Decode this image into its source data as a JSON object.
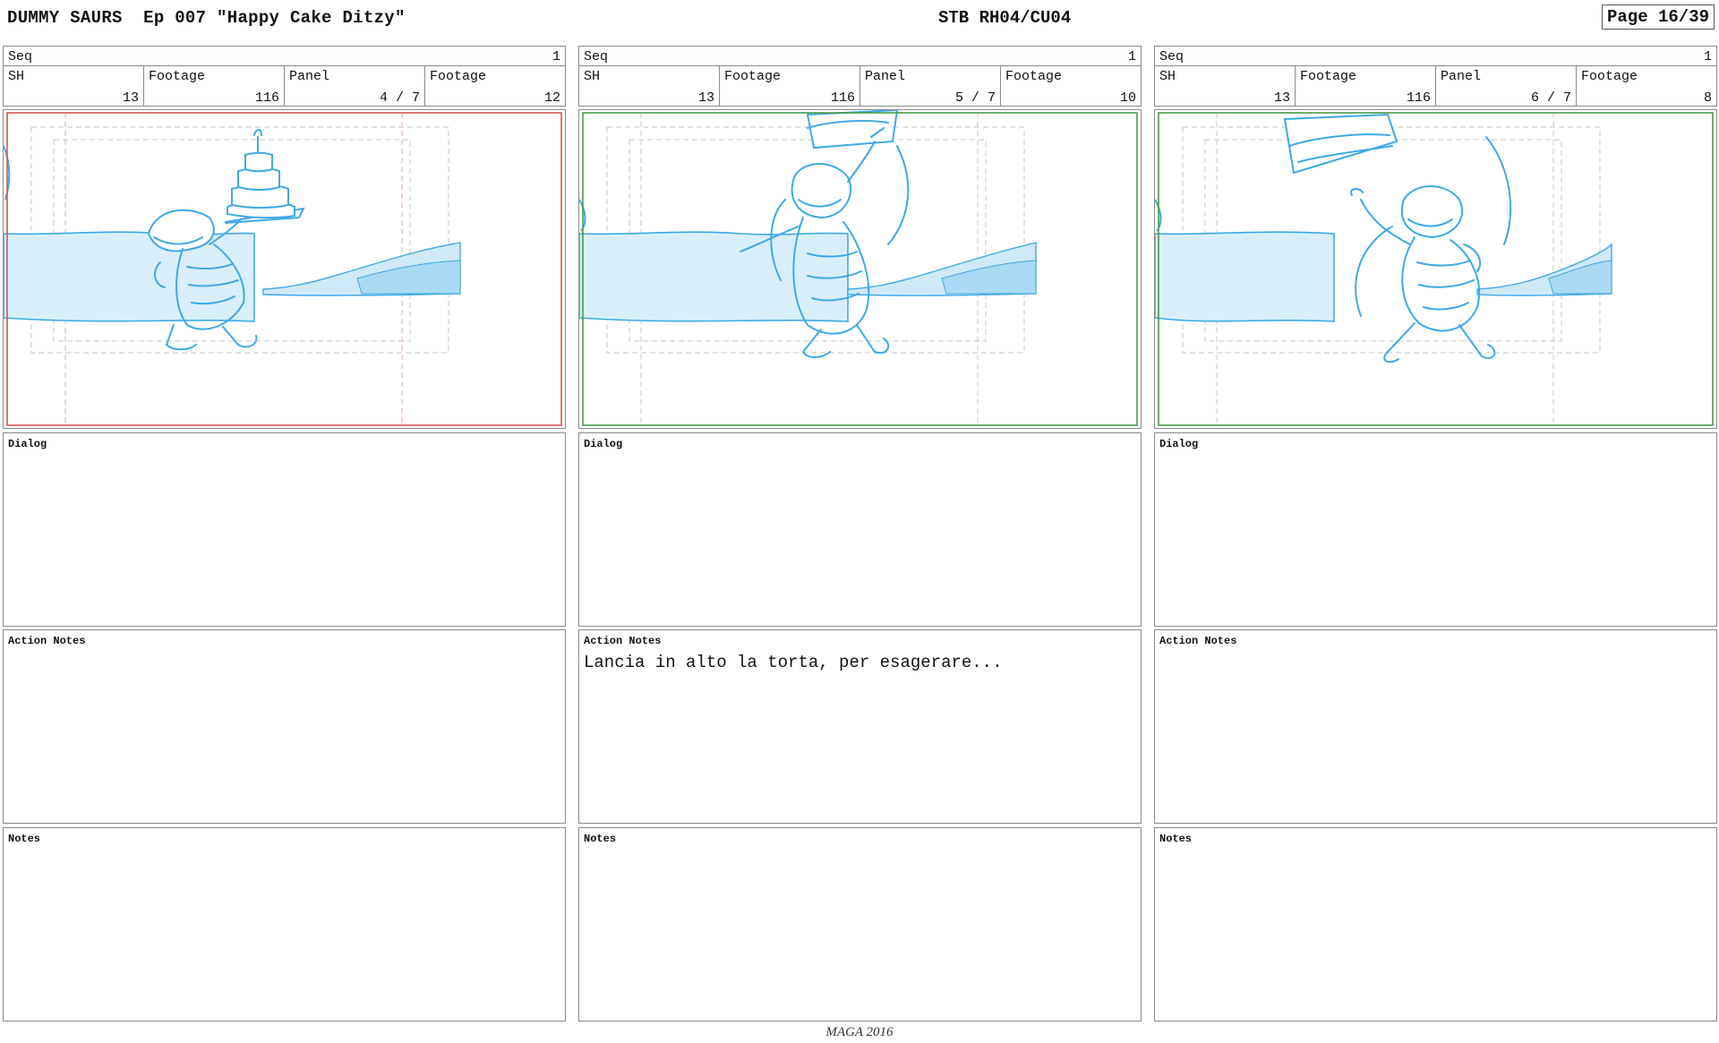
{
  "header": {
    "title": "DUMMY SAURS  Ep 007 \"Happy Cake Ditzy\"",
    "stb_code": "STB RH04/CU04",
    "page": "Page 16/39"
  },
  "labels": {
    "seq": "Seq",
    "sh": "SH",
    "footage": "Footage",
    "panel": "Panel",
    "dialog": "Dialog",
    "action_notes": "Action Notes",
    "notes": "Notes"
  },
  "panels": [
    {
      "seq": "1",
      "sh": "13",
      "footage": "116",
      "panel": "4 / 7",
      "panel_footage": "12",
      "frame_color": "#d9534f",
      "drawing": "dinosaur holding a tiered birthday cake with a candle",
      "dialog": "",
      "action_notes": "",
      "notes": ""
    },
    {
      "seq": "1",
      "sh": "13",
      "footage": "116",
      "panel": "5 / 7",
      "panel_footage": "10",
      "frame_color": "#4a9a4a",
      "drawing": "dinosaur tossing the cake upward",
      "dialog": "",
      "action_notes": "Lancia in alto la torta, per esagerare...",
      "notes": ""
    },
    {
      "seq": "1",
      "sh": "13",
      "footage": "116",
      "panel": "6 / 7",
      "panel_footage": "8",
      "frame_color": "#4a9a4a",
      "drawing": "dinosaur jumping while cake flies above",
      "dialog": "",
      "action_notes": "",
      "notes": ""
    }
  ],
  "footer": "MAGA 2016",
  "colors": {
    "sketch": "#3fa9e6",
    "water": "#d8effb",
    "water_dark": "#a9dbf5",
    "guide": "#c9c9c9",
    "safe_red": "#e4a8a8"
  }
}
